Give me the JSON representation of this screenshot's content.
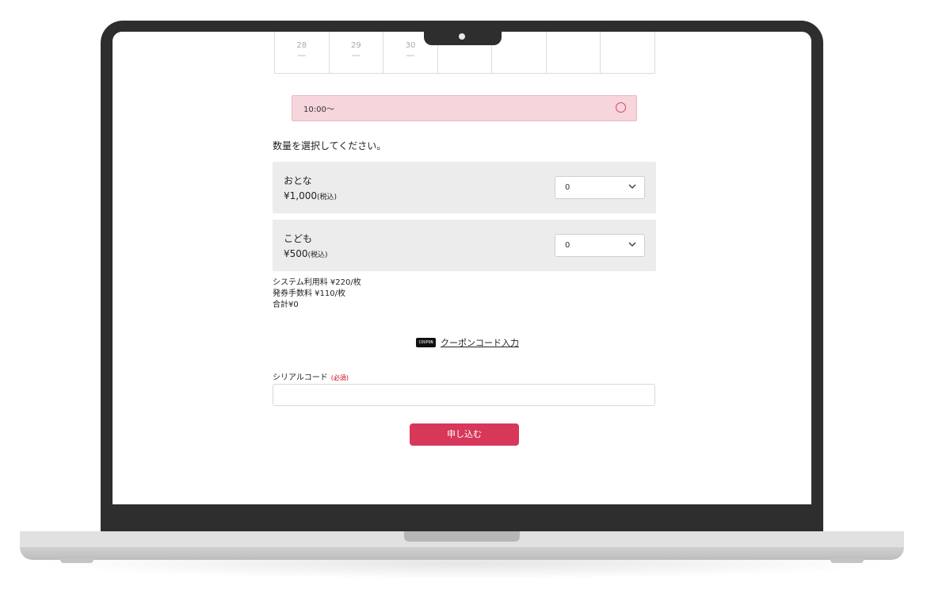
{
  "calendar": {
    "days": [
      {
        "day": "28",
        "mark": "—"
      },
      {
        "day": "29",
        "mark": "—"
      },
      {
        "day": "30",
        "mark": "—"
      },
      {
        "day": "",
        "mark": ""
      },
      {
        "day": "",
        "mark": ""
      },
      {
        "day": "",
        "mark": ""
      },
      {
        "day": "",
        "mark": ""
      }
    ]
  },
  "time_slot": {
    "time": "10:00〜",
    "availability_icon": "circle-available-icon"
  },
  "prompt": "数量を選択してください。",
  "tickets": [
    {
      "name": "おとな",
      "price": "¥1,000",
      "tax_note": "(税込)",
      "quantity": "0"
    },
    {
      "name": "こども",
      "price": "¥500",
      "tax_note": "(税込)",
      "quantity": "0"
    }
  ],
  "fees": {
    "system_fee": "システム利用料 ¥220/枚",
    "issue_fee": "発券手数料 ¥110/枚",
    "total": "合計¥0"
  },
  "coupon": {
    "icon_text": "COUPON",
    "link_label": "クーポンコード入力"
  },
  "serial": {
    "label": "シリアルコード",
    "required": "(必須)",
    "value": ""
  },
  "submit_label": "申し込む",
  "colors": {
    "accent": "#d7385a",
    "slot_bg": "#f6d5dc",
    "box_bg": "#ececec"
  }
}
